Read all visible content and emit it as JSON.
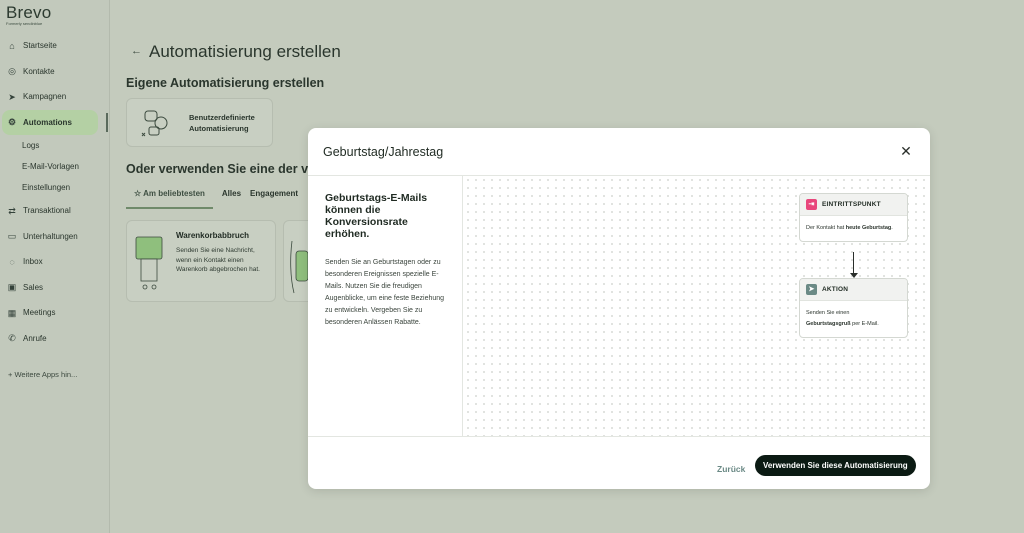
{
  "brand": {
    "name": "Brevo",
    "tagline": "Formerly sendinblue"
  },
  "sidebar": {
    "items": [
      {
        "label": "Startseite",
        "icon": "home-icon"
      },
      {
        "label": "Kontakte",
        "icon": "contacts-icon"
      },
      {
        "label": "Kampagnen",
        "icon": "send-icon"
      },
      {
        "label": "Automations",
        "icon": "automation-icon",
        "active": true
      },
      {
        "label": "Logs"
      },
      {
        "label": "E-Mail-Vorlagen"
      },
      {
        "label": "Einstellungen"
      },
      {
        "label": "Transaktional",
        "icon": "transactional-icon"
      },
      {
        "label": "Unterhaltungen",
        "icon": "chat-icon"
      },
      {
        "label": "Inbox",
        "icon": "inbox-icon"
      },
      {
        "label": "Sales",
        "icon": "sales-icon"
      },
      {
        "label": "Meetings",
        "icon": "calendar-icon"
      },
      {
        "label": "Anrufe",
        "icon": "phone-icon"
      }
    ],
    "more_apps": "+ Weitere Apps hin..."
  },
  "main": {
    "title": "Automatisierung erstellen",
    "custom_section_title": "Eigene Automatisierung erstellen",
    "custom_card_label_1": "Benutzerdefinierte",
    "custom_card_label_2": "Automatisierung",
    "templates_section_title": "Oder verwenden Sie eine der vor",
    "tabs": [
      "Am beliebtesten",
      "Alles",
      "Engagement"
    ],
    "template_card": {
      "title": "Warenkorbabbruch",
      "description": "Senden Sie eine Nachricht, wenn ein Kontakt einen Warenkorb abgebrochen hat."
    }
  },
  "modal": {
    "title": "Geburtstag/Jahrestag",
    "heading": "Geburtstags-E-Mails können die Konversionsrate erhöhen.",
    "description": "Senden Sie an Geburtstagen oder zu besonderen Ereignissen spezielle E-Mails. Nutzen Sie die freudigen Augenblicke, um eine feste Beziehung zu entwickeln. Vergeben Sie zu besonderen Anlässen Rabatte.",
    "entry_node": {
      "label": "EINTRITTSPUNKT",
      "text_1": "Der Kontakt hat ",
      "text_bold": "heute Geburtstag",
      "text_2": "."
    },
    "action_node": {
      "label": "AKTION",
      "text_1": "Senden Sie einen ",
      "text_bold": "Geburtstagsgruß",
      "text_2": " per E-Mail."
    },
    "back_label": "Zurück",
    "use_label": "Verwenden Sie diese Automatisierung",
    "entry_color": "#e8467c",
    "action_color": "#6b8a86"
  }
}
